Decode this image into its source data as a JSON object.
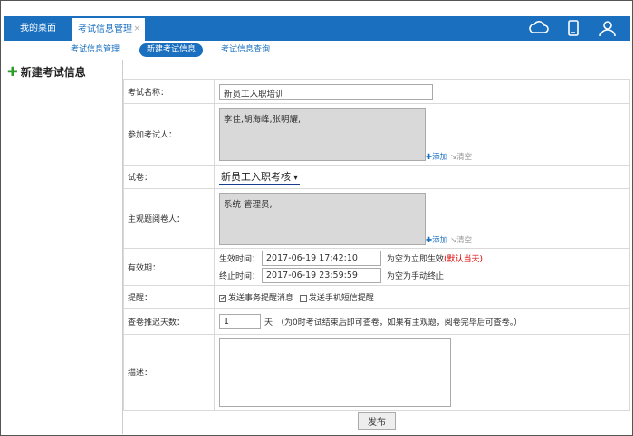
{
  "tabs": {
    "home": "我的桌面",
    "active": "考试信息管理",
    "close": "×"
  },
  "subnav": {
    "items": [
      "考试信息管理",
      "新建考试信息",
      "考试信息查询"
    ]
  },
  "page_title": "新建考试信息",
  "form": {
    "name_label": "考试名称：",
    "name_value": "新员工入职培训",
    "participants_label": "参加考试人：",
    "participants_value": "李佳,胡海峰,张明耀,",
    "add": "添加",
    "clear": "清空",
    "paper_label": "试卷：",
    "paper_value": "新员工入职考核",
    "paper_arrow": "▾",
    "reviewer_label": "主观题阅卷人：",
    "reviewer_value": "系统 管理员,",
    "period_label": "有效期：",
    "start_label": "生效时间：",
    "start_value": "2017-06-19 17:42:10",
    "start_hint": "为空为立即生效",
    "start_hint_red": "(默认当天)",
    "end_label": "终止时间：",
    "end_value": "2017-06-19 23:59:59",
    "end_hint": "为空为手动终止",
    "remind_label": "提醒：",
    "remind_opt1": "发送事务提醒消息",
    "remind_opt2": "发送手机短信提醒",
    "delay_label": "查卷推迟天数：",
    "delay_value": "1",
    "delay_unit": "天",
    "delay_hint": "（为0时考试结束后即可查卷，如果有主观题，阅卷完毕后可查卷。）",
    "desc_label": "描述：",
    "submit": "发布"
  }
}
